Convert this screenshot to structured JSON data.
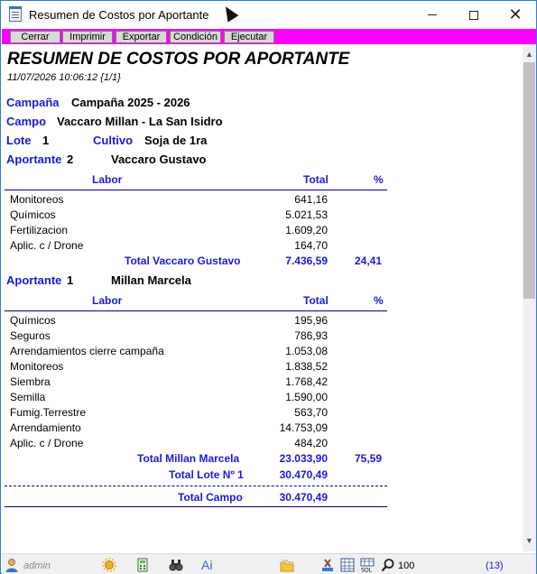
{
  "window": {
    "title": "Resumen de Costos por Aportante"
  },
  "toolbar": {
    "buttons": [
      "Cerrar",
      "Imprimir",
      "Exportar",
      "Condición",
      "Ejecutar"
    ]
  },
  "report": {
    "title": "RESUMEN DE COSTOS POR APORTANTE",
    "datetime": "11/07/2026 10:06:12 {1/1}",
    "campana_label": "Campaña",
    "campana_value": "Campaña 2025 - 2026",
    "campo_label": "Campo",
    "campo_value": "Vaccaro Millan - La San Isidro",
    "lote_label": "Lote",
    "lote_value": "1",
    "cultivo_label": "Cultivo",
    "cultivo_value": "Soja de 1ra",
    "aportante_label": "Aportante",
    "col_labor": "Labor",
    "col_total": "Total",
    "col_pct": "%",
    "groups": [
      {
        "num": "2",
        "name": "Vaccaro Gustavo",
        "rows": [
          [
            "Monitoreos",
            "641,16"
          ],
          [
            "Químicos",
            "5.021,53"
          ],
          [
            "Fertilizacion",
            "1.609,20"
          ],
          [
            "Aplic. c / Drone",
            "164,70"
          ]
        ],
        "total_label": "Total  Vaccaro Gustavo",
        "total": "7.436,59",
        "pct": "24,41"
      },
      {
        "num": "1",
        "name": "Millan Marcela",
        "rows": [
          [
            "Químicos",
            "195,96"
          ],
          [
            "Seguros",
            "786,93"
          ],
          [
            "Arrendamientos cierre campaña",
            "1.053,08"
          ],
          [
            "Monitoreos",
            "1.838,52"
          ],
          [
            "Siembra",
            "1.768,42"
          ],
          [
            "Semilla",
            "1.590,00"
          ],
          [
            "Fumig.Terrestre",
            "563,70"
          ],
          [
            "Arrendamiento",
            "14.753,09"
          ],
          [
            "Aplic. c / Drone",
            "484,20"
          ]
        ],
        "total_label": "Total  Millan Marcela",
        "total": "23.033,90",
        "pct": "75,59"
      }
    ],
    "total_lote_label": "Total Lote Nº 1",
    "total_lote": "30.470,49",
    "total_campo_label": "Total Campo",
    "total_campo": "30.470,49"
  },
  "status": {
    "user": "admin",
    "ai_label": "Ai",
    "zoom": "100",
    "count": "(13)"
  },
  "colors": {
    "toolbar": "#ff00ff",
    "label_blue": "#1a1ad6",
    "rule": "#00008b"
  }
}
